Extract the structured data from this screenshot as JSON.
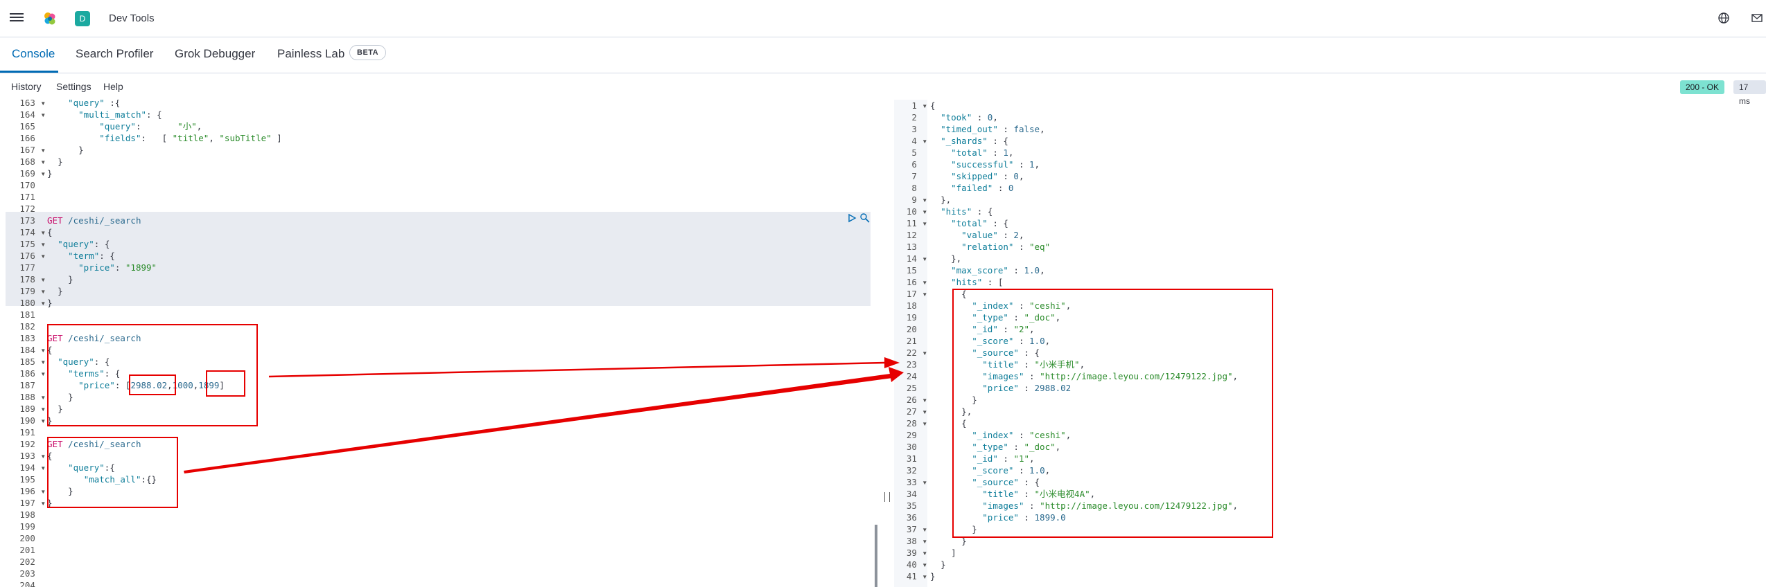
{
  "header": {
    "space_letter": "D",
    "app_title": "Dev Tools"
  },
  "tabs": [
    {
      "label": "Console"
    },
    {
      "label": "Search Profiler"
    },
    {
      "label": "Grok Debugger"
    },
    {
      "label": "Painless Lab"
    }
  ],
  "beta_label": "BETA",
  "subnav": {
    "history": "History",
    "settings": "Settings",
    "help": "Help"
  },
  "status": {
    "code": "200 - OK",
    "time": "17 ms",
    "ok_color": "#7de2d1"
  },
  "request_lines": [
    {
      "n": "163",
      "fold": true,
      "html": "    \"query\" :{"
    },
    {
      "n": "164",
      "fold": true,
      "html": "      \"multi_match\": {"
    },
    {
      "n": "165",
      "fold": false,
      "html": "          \"query\":       \"小\","
    },
    {
      "n": "166",
      "fold": false,
      "html": "          \"fields\":   [ \"title\", \"subTitle\" ]"
    },
    {
      "n": "167",
      "fold": true,
      "html": "      }"
    },
    {
      "n": "168",
      "fold": true,
      "html": "  }"
    },
    {
      "n": "169",
      "fold": true,
      "html": "}"
    },
    {
      "n": "170",
      "fold": false,
      "html": ""
    },
    {
      "n": "171",
      "fold": false,
      "html": ""
    },
    {
      "n": "172",
      "fold": false,
      "html": ""
    },
    {
      "n": "173",
      "fold": false,
      "html": "GET /ceshi/_search"
    },
    {
      "n": "174",
      "fold": true,
      "html": "{"
    },
    {
      "n": "175",
      "fold": true,
      "html": "  \"query\": {"
    },
    {
      "n": "176",
      "fold": true,
      "html": "    \"term\": {"
    },
    {
      "n": "177",
      "fold": false,
      "html": "      \"price\": \"1899\""
    },
    {
      "n": "178",
      "fold": true,
      "html": "    }"
    },
    {
      "n": "179",
      "fold": true,
      "html": "  }"
    },
    {
      "n": "180",
      "fold": true,
      "html": "}"
    },
    {
      "n": "181",
      "fold": false,
      "html": ""
    },
    {
      "n": "182",
      "fold": false,
      "html": ""
    },
    {
      "n": "183",
      "fold": false,
      "html": "GET /ceshi/_search"
    },
    {
      "n": "184",
      "fold": true,
      "html": "{"
    },
    {
      "n": "185",
      "fold": true,
      "html": "  \"query\": {"
    },
    {
      "n": "186",
      "fold": true,
      "html": "    \"terms\": {"
    },
    {
      "n": "187",
      "fold": false,
      "html": "      \"price\": [2988.02,1000,1899]"
    },
    {
      "n": "188",
      "fold": true,
      "html": "    }"
    },
    {
      "n": "189",
      "fold": true,
      "html": "  }"
    },
    {
      "n": "190",
      "fold": true,
      "html": "}"
    },
    {
      "n": "191",
      "fold": false,
      "html": ""
    },
    {
      "n": "192",
      "fold": false,
      "html": "GET /ceshi/_search"
    },
    {
      "n": "193",
      "fold": true,
      "html": "{"
    },
    {
      "n": "194",
      "fold": true,
      "html": "    \"query\":{"
    },
    {
      "n": "195",
      "fold": false,
      "html": "       \"match_all\":{}"
    },
    {
      "n": "196",
      "fold": true,
      "html": "    }"
    },
    {
      "n": "197",
      "fold": true,
      "html": "}"
    },
    {
      "n": "198",
      "fold": false,
      "html": ""
    },
    {
      "n": "199",
      "fold": false,
      "html": ""
    },
    {
      "n": "200",
      "fold": false,
      "html": ""
    },
    {
      "n": "201",
      "fold": false,
      "html": ""
    },
    {
      "n": "202",
      "fold": false,
      "html": ""
    },
    {
      "n": "203",
      "fold": false,
      "html": ""
    },
    {
      "n": "204",
      "fold": false,
      "html": ""
    }
  ],
  "response_lines": [
    {
      "n": "1",
      "fold": true,
      "html": "{"
    },
    {
      "n": "2",
      "fold": false,
      "html": "  \"took\" : 0,"
    },
    {
      "n": "3",
      "fold": false,
      "html": "  \"timed_out\" : false,"
    },
    {
      "n": "4",
      "fold": true,
      "html": "  \"_shards\" : {"
    },
    {
      "n": "5",
      "fold": false,
      "html": "    \"total\" : 1,"
    },
    {
      "n": "6",
      "fold": false,
      "html": "    \"successful\" : 1,"
    },
    {
      "n": "7",
      "fold": false,
      "html": "    \"skipped\" : 0,"
    },
    {
      "n": "8",
      "fold": false,
      "html": "    \"failed\" : 0"
    },
    {
      "n": "9",
      "fold": true,
      "html": "  },"
    },
    {
      "n": "10",
      "fold": true,
      "html": "  \"hits\" : {"
    },
    {
      "n": "11",
      "fold": true,
      "html": "    \"total\" : {"
    },
    {
      "n": "12",
      "fold": false,
      "html": "      \"value\" : 2,"
    },
    {
      "n": "13",
      "fold": false,
      "html": "      \"relation\" : \"eq\""
    },
    {
      "n": "14",
      "fold": true,
      "html": "    },"
    },
    {
      "n": "15",
      "fold": false,
      "html": "    \"max_score\" : 1.0,"
    },
    {
      "n": "16",
      "fold": true,
      "html": "    \"hits\" : ["
    },
    {
      "n": "17",
      "fold": true,
      "html": "      {"
    },
    {
      "n": "18",
      "fold": false,
      "html": "        \"_index\" : \"ceshi\","
    },
    {
      "n": "19",
      "fold": false,
      "html": "        \"_type\" : \"_doc\","
    },
    {
      "n": "20",
      "fold": false,
      "html": "        \"_id\" : \"2\","
    },
    {
      "n": "21",
      "fold": false,
      "html": "        \"_score\" : 1.0,"
    },
    {
      "n": "22",
      "fold": true,
      "html": "        \"_source\" : {"
    },
    {
      "n": "23",
      "fold": false,
      "html": "          \"title\" : \"小米手机\","
    },
    {
      "n": "24",
      "fold": false,
      "html": "          \"images\" : \"http://image.leyou.com/12479122.jpg\","
    },
    {
      "n": "25",
      "fold": false,
      "html": "          \"price\" : 2988.02"
    },
    {
      "n": "26",
      "fold": true,
      "html": "        }"
    },
    {
      "n": "27",
      "fold": true,
      "html": "      },"
    },
    {
      "n": "28",
      "fold": true,
      "html": "      {"
    },
    {
      "n": "29",
      "fold": false,
      "html": "        \"_index\" : \"ceshi\","
    },
    {
      "n": "30",
      "fold": false,
      "html": "        \"_type\" : \"_doc\","
    },
    {
      "n": "31",
      "fold": false,
      "html": "        \"_id\" : \"1\","
    },
    {
      "n": "32",
      "fold": false,
      "html": "        \"_score\" : 1.0,"
    },
    {
      "n": "33",
      "fold": true,
      "html": "        \"_source\" : {"
    },
    {
      "n": "34",
      "fold": false,
      "html": "          \"title\" : \"小米电视4A\","
    },
    {
      "n": "35",
      "fold": false,
      "html": "          \"images\" : \"http://image.leyou.com/12479122.jpg\","
    },
    {
      "n": "36",
      "fold": false,
      "html": "          \"price\" : 1899.0"
    },
    {
      "n": "37",
      "fold": true,
      "html": "        }"
    },
    {
      "n": "38",
      "fold": true,
      "html": "      }"
    },
    {
      "n": "39",
      "fold": true,
      "html": "    ]"
    },
    {
      "n": "40",
      "fold": true,
      "html": "  }"
    },
    {
      "n": "41",
      "fold": true,
      "html": "}"
    }
  ]
}
